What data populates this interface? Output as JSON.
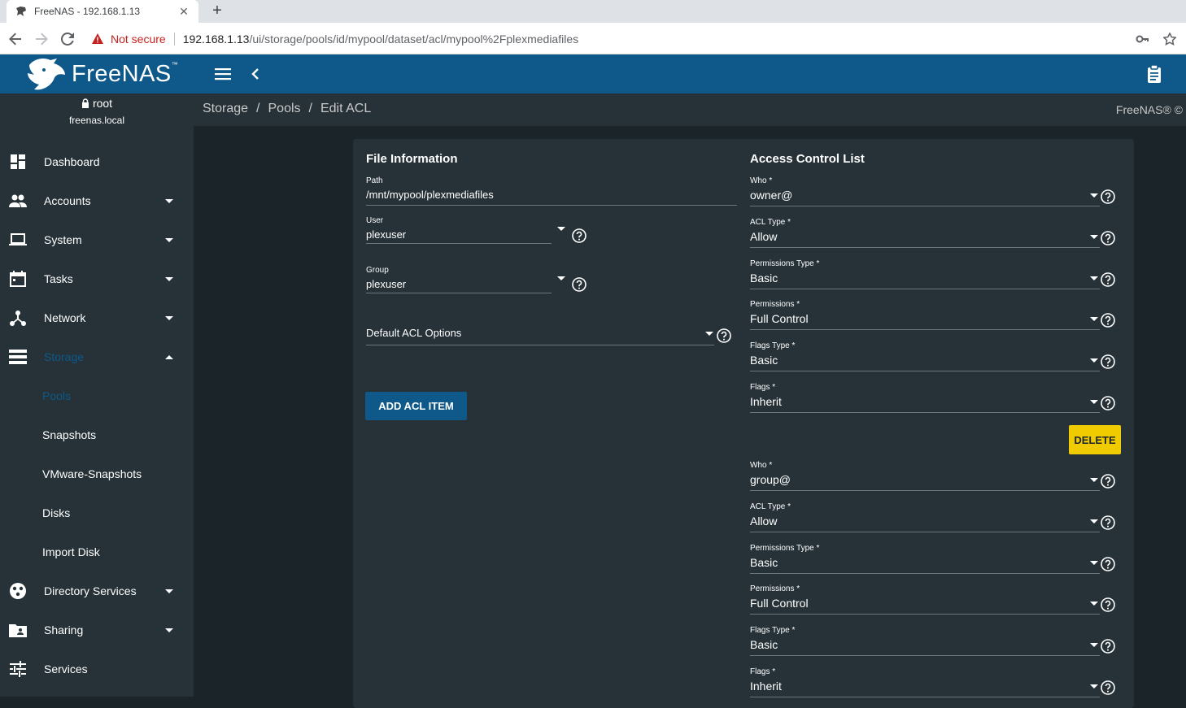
{
  "browser": {
    "tab_title": "FreeNAS - 192.168.1.13",
    "security_label": "Not secure",
    "url_host": "192.168.1.13",
    "url_path": "/ui/storage/pools/id/mypool/dataset/acl/mypool%2Fplexmediafiles"
  },
  "header": {
    "logo_text": "FreeNAS",
    "logo_tm": "™"
  },
  "sidebar": {
    "user": "root",
    "hostname": "freenas.local",
    "items": [
      {
        "label": "Dashboard"
      },
      {
        "label": "Accounts"
      },
      {
        "label": "System"
      },
      {
        "label": "Tasks"
      },
      {
        "label": "Network"
      },
      {
        "label": "Storage"
      },
      {
        "label": "Directory Services"
      },
      {
        "label": "Sharing"
      },
      {
        "label": "Services"
      }
    ],
    "storage_sub": [
      "Pools",
      "Snapshots",
      "VMware-Snapshots",
      "Disks",
      "Import Disk"
    ]
  },
  "breadcrumb": {
    "items": [
      "Storage",
      "Pools",
      "Edit ACL"
    ],
    "separator": "/",
    "brand": "FreeNAS® ©"
  },
  "file_info": {
    "title": "File Information",
    "path_label": "Path",
    "path_value": "/mnt/mypool/plexmediafiles",
    "user_label": "User",
    "user_value": "plexuser",
    "group_label": "Group",
    "group_value": "plexuser",
    "default_acl_label": "Default ACL Options",
    "add_button": "ADD ACL ITEM"
  },
  "acl": {
    "title": "Access Control List",
    "delete_button": "DELETE",
    "entries": [
      {
        "who_label": "Who *",
        "who": "owner@",
        "type_label": "ACL Type *",
        "type": "Allow",
        "ptype_label": "Permissions Type *",
        "ptype": "Basic",
        "perm_label": "Permissions *",
        "perm": "Full Control",
        "ftype_label": "Flags Type *",
        "ftype": "Basic",
        "flags_label": "Flags *",
        "flags": "Inherit"
      },
      {
        "who_label": "Who *",
        "who": "group@",
        "type_label": "ACL Type *",
        "type": "Allow",
        "ptype_label": "Permissions Type *",
        "ptype": "Basic",
        "perm_label": "Permissions *",
        "perm": "Full Control",
        "ftype_label": "Flags Type *",
        "ftype": "Basic",
        "flags_label": "Flags *",
        "flags": "Inherit"
      }
    ]
  },
  "colors": {
    "header": "#0e5989",
    "sidebar": "#263238",
    "background": "#1b2529",
    "delete": "#f0cb00"
  }
}
